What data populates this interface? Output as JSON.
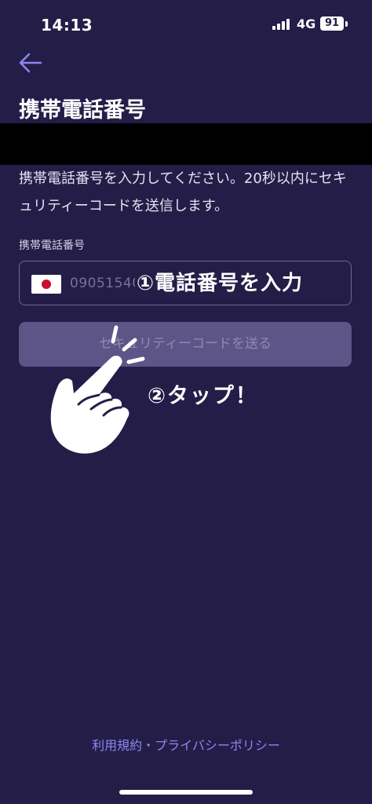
{
  "status_bar": {
    "time": "14:13",
    "network": "4G",
    "battery": "91"
  },
  "header": {
    "back_icon": "arrow-left-icon",
    "title": "携帯電話番号"
  },
  "form": {
    "description": "携帯電話番号を入力してください。20秒以内にセキュリティーコードを送信します。",
    "field_label": "携帯電話番号",
    "country_flag": "japan-flag-icon",
    "phone_value": "09051540",
    "send_button_label": "セキュリティーコードを送る"
  },
  "annotations": {
    "step1": "①電話番号を入力",
    "step2": "②タップ！"
  },
  "footer": {
    "links": "利用規約・プライバシーポリシー"
  },
  "colors": {
    "background": "#241d47",
    "accent": "#8d86f2",
    "button_disabled": "#5d5587"
  }
}
